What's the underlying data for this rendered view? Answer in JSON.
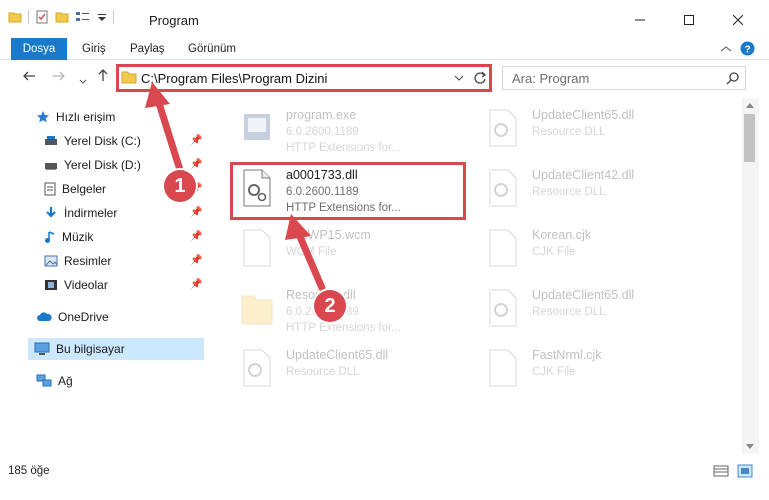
{
  "window": {
    "title": "Program"
  },
  "ribbon": {
    "tabs": [
      "Dosya",
      "Giriş",
      "Paylaş",
      "Görünüm"
    ]
  },
  "address": {
    "path": "C:\\Program Files\\Program Dizini",
    "search_placeholder": "Ara: Program"
  },
  "sidebar": {
    "items": [
      {
        "label": "Hızlı erişim",
        "icon": "star-icon"
      },
      {
        "label": "Yerel Disk (C:)",
        "icon": "drive-icon",
        "pinned": true
      },
      {
        "label": "Yerel Disk (D:)",
        "icon": "drive-icon",
        "pinned": true
      },
      {
        "label": "Belgeler",
        "icon": "documents-icon",
        "pinned": true
      },
      {
        "label": "İndirmeler",
        "icon": "download-icon",
        "pinned": true
      },
      {
        "label": "Müzik",
        "icon": "music-icon",
        "pinned": true
      },
      {
        "label": "Resimler",
        "icon": "pictures-icon",
        "pinned": true
      },
      {
        "label": "Videolar",
        "icon": "videos-icon",
        "pinned": true
      },
      {
        "label": "OneDrive",
        "icon": "cloud-icon"
      },
      {
        "label": "Bu bilgisayar",
        "icon": "computer-icon",
        "selected": true
      },
      {
        "label": "Ağ",
        "icon": "network-icon"
      }
    ]
  },
  "files": [
    {
      "name": "program.exe",
      "line2": "6.0.2600.1189",
      "line3": "HTTP Extensions for..."
    },
    {
      "name": "UpdateClient65.dll",
      "line2": "Resource DLL",
      "line3": ""
    },
    {
      "name": "a0001733.dll",
      "line2": "6.0.2600.1189",
      "line3": "HTTP Extensions for..."
    },
    {
      "name": "UpdateClient42.dll",
      "line2": "Resource DLL",
      "line3": ""
    },
    {
      "name": "SiteWP15.wcm",
      "line2": "WCM File",
      "line3": ""
    },
    {
      "name": "Korean.cjk",
      "line2": "CJK File",
      "line3": ""
    },
    {
      "name": "Resource.dll",
      "line2": "6.0.2600.1189",
      "line3": "HTTP Extensions for..."
    },
    {
      "name": "UpdateClient65.dll",
      "line2": "Resource DLL",
      "line3": ""
    },
    {
      "name": "UpdateClient65.dll",
      "line2": "Resource DLL",
      "line3": ""
    },
    {
      "name": "FastNrml.cjk",
      "line2": "CJK File",
      "line3": ""
    }
  ],
  "status": {
    "count": "185 öğe"
  },
  "annotations": {
    "step1": "1",
    "step2": "2",
    "color": "#d9474f"
  }
}
